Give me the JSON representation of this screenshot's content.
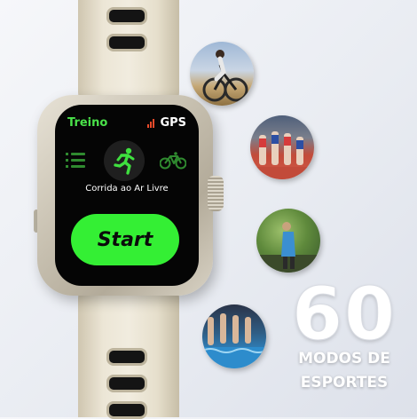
{
  "watch": {
    "title": "Treino",
    "gps_label": "GPS",
    "selected_mode": "Corrida ao Ar Livre",
    "start_label": "Start",
    "modes": [
      "list-icon",
      "running-icon",
      "cycling-icon"
    ]
  },
  "photos": [
    "cycling",
    "running",
    "hiking",
    "swimming"
  ],
  "promo": {
    "number": "60",
    "line1": "MODOS DE",
    "line2": "ESPORTES"
  },
  "colors": {
    "accent_green": "#34ef34",
    "title_green": "#4ae24a",
    "screen": "#050505"
  }
}
